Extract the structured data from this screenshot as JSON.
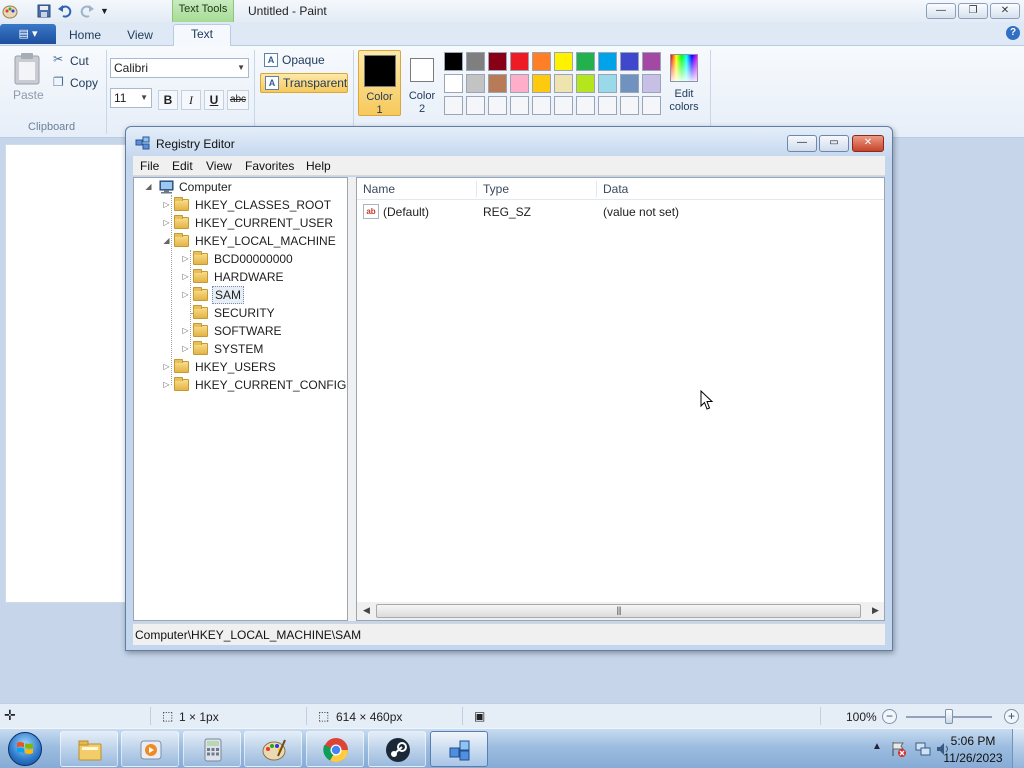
{
  "paint": {
    "window_title": "Untitled - Paint",
    "context_tab_group": "Text Tools",
    "tabs": [
      "Home",
      "View",
      "Text"
    ],
    "active_tab": "Text",
    "clipboard": {
      "paste_label": "Paste",
      "cut_label": "Cut",
      "copy_label": "Copy",
      "group_label": "Clipboard"
    },
    "font": {
      "family": "Calibri",
      "size": "11",
      "bold": "B",
      "italic": "I",
      "underline": "U",
      "strike": "abc"
    },
    "background": {
      "opaque_label": "Opaque",
      "transparent_label": "Transparent",
      "selected": "Transparent"
    },
    "colors": {
      "color1_label_1": "Color",
      "color1_label_2": "1",
      "color1_value": "#000000",
      "color2_label_1": "Color",
      "color2_label_2": "2",
      "color2_value": "#ffffff",
      "edit_label_1": "Edit",
      "edit_label_2": "colors",
      "palette_row1": [
        "#000000",
        "#7f7f7f",
        "#880015",
        "#ed1c24",
        "#ff7f27",
        "#fff200",
        "#22b14c",
        "#00a2e8",
        "#3f48cc",
        "#a349a4"
      ],
      "palette_row2": [
        "#ffffff",
        "#c3c3c3",
        "#b97a57",
        "#ffaec9",
        "#ffc90e",
        "#efe4b0",
        "#b5e61d",
        "#99d9ea",
        "#7092be",
        "#c8bfe7"
      ],
      "palette_row3": [
        "#f4f6f9",
        "#f4f6f9",
        "#f4f6f9",
        "#f4f6f9",
        "#f4f6f9",
        "#f4f6f9",
        "#f4f6f9",
        "#f4f6f9",
        "#f4f6f9",
        "#f4f6f9"
      ]
    },
    "status": {
      "selection_size": "1 × 1px",
      "canvas_size": "614 × 460px",
      "zoom": "100%",
      "zoom_fraction": 0.5
    }
  },
  "regedit": {
    "window_title": "Registry Editor",
    "menu": [
      "File",
      "Edit",
      "View",
      "Favorites",
      "Help"
    ],
    "tree": {
      "root": "Computer",
      "hives": [
        {
          "label": "HKEY_CLASSES_ROOT",
          "expanded": false
        },
        {
          "label": "HKEY_CURRENT_USER",
          "expanded": false
        },
        {
          "label": "HKEY_LOCAL_MACHINE",
          "expanded": true
        },
        {
          "label": "HKEY_USERS",
          "expanded": false
        },
        {
          "label": "HKEY_CURRENT_CONFIG",
          "expanded": false
        }
      ],
      "hklm_children": [
        {
          "label": "BCD00000000",
          "expandable": true
        },
        {
          "label": "HARDWARE",
          "expandable": true
        },
        {
          "label": "SAM",
          "expandable": true,
          "selected": true
        },
        {
          "label": "SECURITY",
          "expandable": false
        },
        {
          "label": "SOFTWARE",
          "expandable": true
        },
        {
          "label": "SYSTEM",
          "expandable": true
        }
      ]
    },
    "list": {
      "columns": [
        "Name",
        "Type",
        "Data"
      ],
      "rows": [
        {
          "icon": "ab",
          "name": "(Default)",
          "type": "REG_SZ",
          "data": "(value not set)"
        }
      ]
    },
    "status_path": "Computer\\HKEY_LOCAL_MACHINE\\SAM"
  },
  "taskbar": {
    "apps": [
      "windows-explorer",
      "media-player",
      "calculator",
      "paint",
      "chrome",
      "steam",
      "registry-editor"
    ],
    "active_app": "registry-editor",
    "clock_time": "5:06 PM",
    "clock_date": "11/26/2023"
  }
}
